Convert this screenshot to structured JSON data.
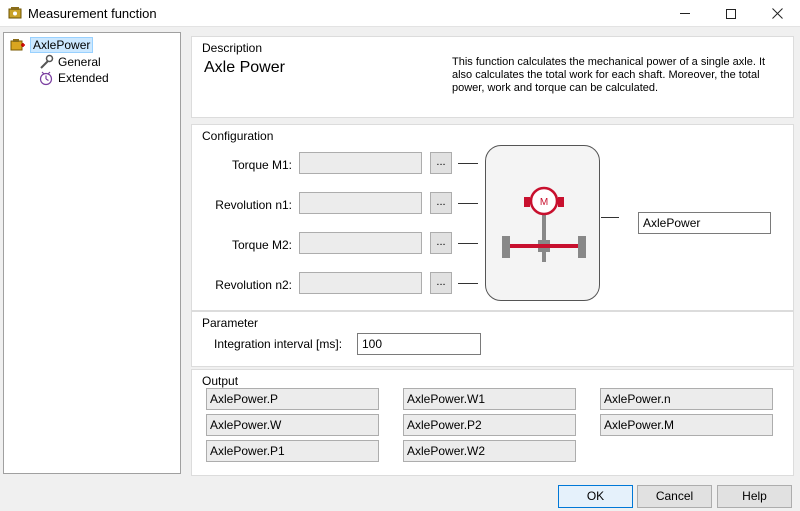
{
  "window": {
    "title": "Measurement function"
  },
  "tree": {
    "root_label": "AxlePower",
    "children": [
      {
        "label": "General"
      },
      {
        "label": "Extended"
      }
    ]
  },
  "description": {
    "group_title": "Description",
    "name": "Axle Power",
    "text": "This function calculates the mechanical power of a single axle. It also calculates the total work for each shaft. Moreover, the total power, work and torque can be calculated."
  },
  "configuration": {
    "group_title": "Configuration",
    "inputs": [
      {
        "label": "Torque M1:",
        "value": "",
        "button": "..."
      },
      {
        "label": "Revolution n1:",
        "value": "",
        "button": "..."
      },
      {
        "label": "Torque M2:",
        "value": "",
        "button": "..."
      },
      {
        "label": "Revolution n2:",
        "value": "",
        "button": "..."
      }
    ],
    "motor_label": "M",
    "output_name": "AxlePower"
  },
  "parameter": {
    "group_title": "Parameter",
    "label": "Integration interval [ms]:",
    "value": "100"
  },
  "output": {
    "group_title": "Output",
    "cells": [
      "AxlePower.P",
      "AxlePower.W1",
      "AxlePower.n",
      "AxlePower.W",
      "AxlePower.P2",
      "AxlePower.M",
      "AxlePower.P1",
      "AxlePower.W2"
    ]
  },
  "buttons": {
    "ok": "OK",
    "cancel": "Cancel",
    "help": "Help"
  },
  "colors": {
    "motor_red": "#c8102e",
    "selection": "#cce8ff",
    "focus_border": "#0078d7"
  }
}
